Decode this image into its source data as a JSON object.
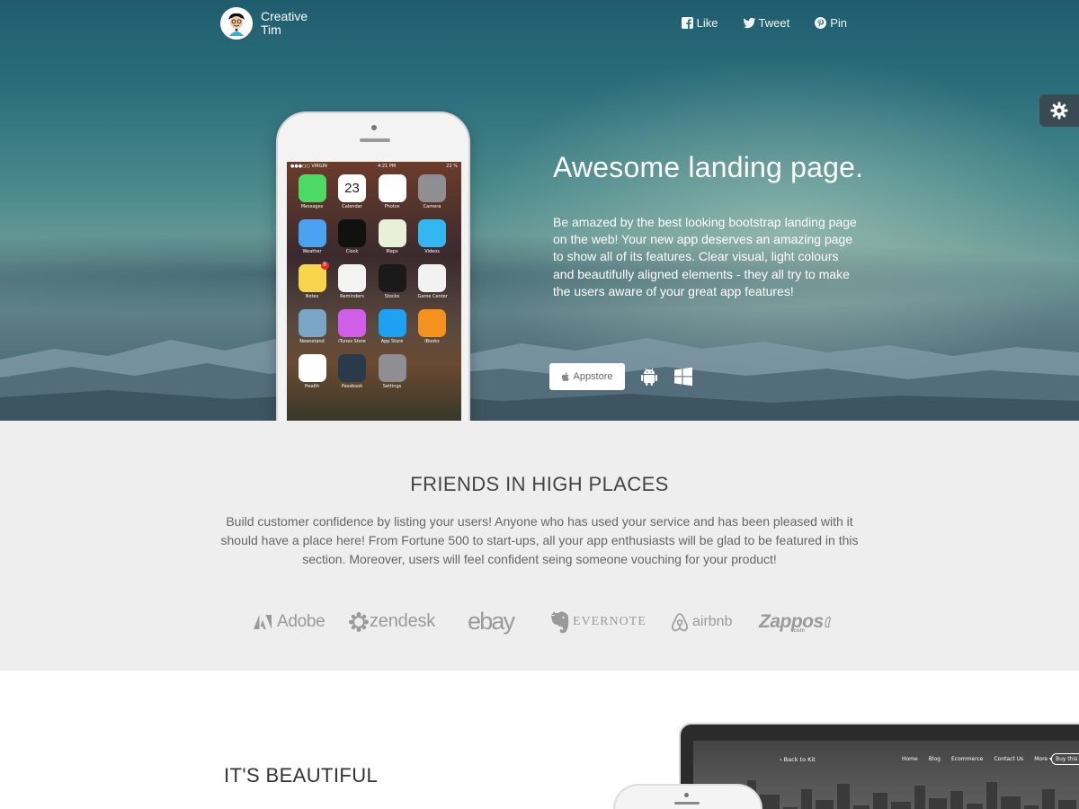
{
  "brand": {
    "line1": "Creative",
    "line2": "Tim"
  },
  "social": [
    {
      "label": "Like",
      "icon": "facebook-icon"
    },
    {
      "label": "Tweet",
      "icon": "twitter-icon"
    },
    {
      "label": "Pin",
      "icon": "pinterest-icon"
    }
  ],
  "settings": {
    "icon": "gear-icon"
  },
  "phone": {
    "carrier": "●●●○○ VIRGIN",
    "time": "4:21 PM",
    "battery": "22 %",
    "calendar_day": "23",
    "apps": [
      {
        "label": "Messages",
        "color": "#4cd964"
      },
      {
        "label": "Calendar",
        "color": "#ffffff"
      },
      {
        "label": "Photos",
        "color": "#ffffff"
      },
      {
        "label": "Camera",
        "color": "#8e8e93"
      },
      {
        "label": "Weather",
        "color": "#4aa3f0"
      },
      {
        "label": "Clock",
        "color": "#111111"
      },
      {
        "label": "Maps",
        "color": "#e8f0d8"
      },
      {
        "label": "Videos",
        "color": "#34b7f1"
      },
      {
        "label": "Notes",
        "color": "#f7d44c"
      },
      {
        "label": "Reminders",
        "color": "#f3f3f3"
      },
      {
        "label": "Stocks",
        "color": "#1a1a1a"
      },
      {
        "label": "Game Center",
        "color": "#f2f2f2"
      },
      {
        "label": "Newsstand",
        "color": "#7aa5c6"
      },
      {
        "label": "iTunes Store",
        "color": "#d05ee8"
      },
      {
        "label": "App Store",
        "color": "#1ea1f2"
      },
      {
        "label": "iBooks",
        "color": "#f5921e"
      },
      {
        "label": "Health",
        "color": "#ffffff"
      },
      {
        "label": "Passbook",
        "color": "#2b3a4a"
      },
      {
        "label": "Settings",
        "color": "#8e8e93"
      }
    ],
    "notes_badge": "8"
  },
  "hero": {
    "title": "Awesome landing page.",
    "description": "Be amazed by the best looking bootstrap landing page on the web! Your new app deserves an amazing page to show all of its features. Clear visual, light colours and beautifully aligned elements - they all try to make the users aware of your great app features!",
    "appstore_label": "Appstore",
    "platform_icons": [
      "apple-icon",
      "android-icon",
      "windows-icon"
    ]
  },
  "friends": {
    "title": "FRIENDS IN HIGH PLACES",
    "description": "Build customer confidence by listing your users! Anyone who has used your service and has been pleased with it should have a place here! From Fortune 500 to start-ups, all your app enthusiasts will be glad to be featured in this section. Moreover, users will feel confident seing someone vouching for your product!",
    "logos": [
      {
        "name": "Adobe"
      },
      {
        "name": "zendesk"
      },
      {
        "name": "ebay"
      },
      {
        "name": "EVERNOTE"
      },
      {
        "name": "airbnb"
      },
      {
        "name": "Zappos",
        "sub": ".com"
      }
    ]
  },
  "beautiful": {
    "title": "IT'S BEAUTIFUL",
    "laptop_nav": {
      "back": "Back to Kit",
      "links": [
        "Home",
        "Blog",
        "Ecommerce",
        "Contact Us",
        "More ▾"
      ],
      "buy": "Buy this Kit"
    }
  },
  "colors": {
    "hero_top": "#1f5d6e",
    "section_gray": "#eeeeee",
    "logo_gray": "#9a9a9a",
    "gear_tab": "#3a4a52"
  }
}
